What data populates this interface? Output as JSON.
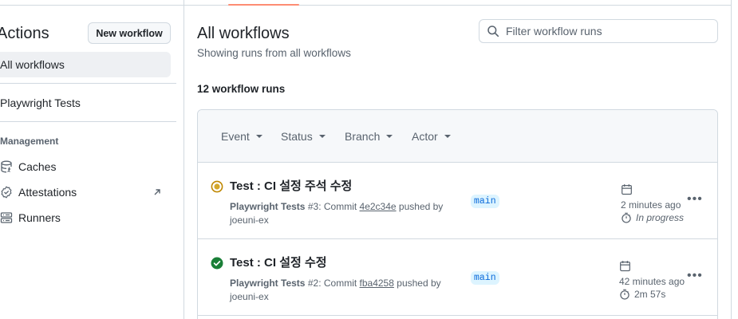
{
  "sidebar": {
    "title": "Actions",
    "new_workflow_label": "New workflow",
    "all_workflows_label": "All workflows",
    "workflows": [
      {
        "label": "Playwright Tests"
      }
    ],
    "management_label": "Management",
    "management_items": [
      {
        "label": "Caches",
        "icon": "database-icon"
      },
      {
        "label": "Attestations",
        "icon": "verified-icon"
      },
      {
        "label": "Runners",
        "icon": "server-icon"
      }
    ]
  },
  "main": {
    "title": "All workflows",
    "subtitle": "Showing runs from all workflows",
    "search_placeholder": "Filter workflow runs",
    "runs_count": "12 workflow runs",
    "filters": [
      "Event",
      "Status",
      "Branch",
      "Actor"
    ],
    "runs": [
      {
        "title": "Test : CI 설정 주석 수정",
        "workflow": "Playwright Tests",
        "run_number": "#3",
        "commit_prefix": ": Commit",
        "sha": "4e2c34e",
        "pushed_by": "pushed by",
        "author": "joeuni-ex",
        "branch": "main",
        "time_ago": "2 minutes ago",
        "status_text": "In progress",
        "status": "in-progress",
        "status_color": "#bf8700"
      },
      {
        "title": "Test : CI 설정 수정",
        "workflow": "Playwright Tests",
        "run_number": "#2",
        "commit_prefix": ": Commit",
        "sha": "fba4258",
        "pushed_by": "pushed by",
        "author": "joeuni-ex",
        "branch": "main",
        "time_ago": "42 minutes ago",
        "status_text": "2m 57s",
        "status": "success",
        "status_color": "#1a7f37"
      }
    ]
  },
  "colors": {
    "accent": "#fd8c73",
    "link": "#0969da",
    "branch_bg": "#ddf4ff"
  }
}
